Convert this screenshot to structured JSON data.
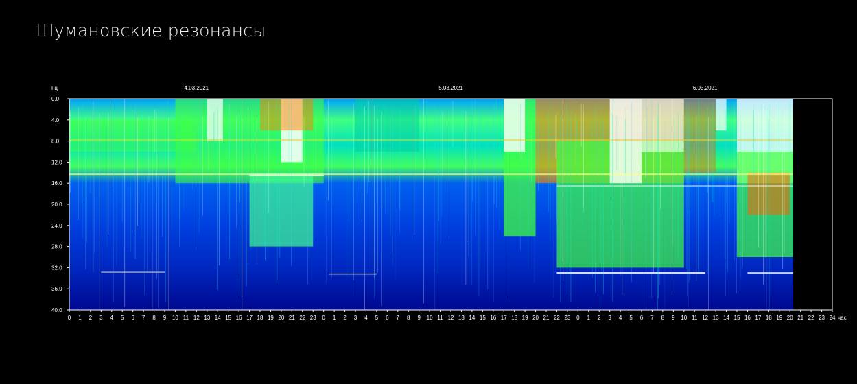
{
  "page": {
    "title": "Шумановские резонансы"
  },
  "chart_data": {
    "type": "heatmap",
    "title": "",
    "ylabel": "Гц",
    "xlabel": "час",
    "dates": [
      "4.03.2021",
      "5.03.2021",
      "6.03.2021"
    ],
    "y_ticks": [
      "0.0",
      "4.0",
      "8.0",
      "12.0",
      "16.0",
      "20.0",
      "24.0",
      "28.0",
      "32.0",
      "36.0",
      "40.0"
    ],
    "x_ticks": [
      "0",
      "1",
      "2",
      "3",
      "4",
      "5",
      "6",
      "7",
      "8",
      "9",
      "10",
      "11",
      "12",
      "13",
      "14",
      "15",
      "16",
      "17",
      "18",
      "19",
      "20",
      "21",
      "22",
      "23",
      "0",
      "1",
      "2",
      "3",
      "4",
      "5",
      "6",
      "7",
      "8",
      "9",
      "10",
      "11",
      "12",
      "13",
      "14",
      "15",
      "16",
      "17",
      "18",
      "19",
      "20",
      "21",
      "22",
      "23",
      "0",
      "1",
      "2",
      "3",
      "4",
      "5",
      "6",
      "7",
      "8",
      "9",
      "10",
      "11",
      "12",
      "13",
      "14",
      "15",
      "16",
      "17",
      "18",
      "19",
      "20",
      "21",
      "22",
      "23",
      "24"
    ],
    "ylim": [
      0,
      40
    ],
    "x_range_hours": [
      0,
      72
    ],
    "data_end_hour": 68.3,
    "y_inverted": true,
    "colorscale": [
      "#000060",
      "#0020d0",
      "#00a0ff",
      "#00ffd0",
      "#40ff40",
      "#ffff00",
      "#ff8000",
      "#ff3000",
      "#ffffff"
    ]
  }
}
